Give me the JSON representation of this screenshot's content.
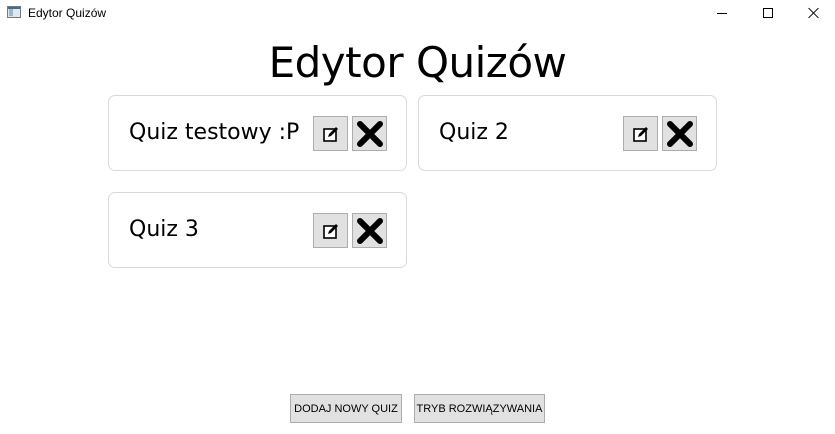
{
  "window": {
    "title": "Edytor Quizów",
    "icon": "app-window-icon",
    "controls": [
      "minimize-icon",
      "maximize-icon",
      "close-icon"
    ]
  },
  "header": {
    "title": "Edytor Quizów"
  },
  "quizzes": [
    {
      "name": "Quiz testowy :P",
      "edit_icon": "edit-icon",
      "delete_icon": "delete-x-icon"
    },
    {
      "name": "Quiz 2",
      "edit_icon": "edit-icon",
      "delete_icon": "delete-x-icon"
    },
    {
      "name": "Quiz 3",
      "edit_icon": "edit-icon",
      "delete_icon": "delete-x-icon"
    }
  ],
  "actions": {
    "add_label": "DODAJ NOWY QUIZ",
    "solve_label": "TRYB ROZWIĄZYWANIA"
  },
  "colors": {
    "button_bg": "#e1e1e1",
    "button_border": "#adadad",
    "card_border": "#d9d9d9"
  }
}
